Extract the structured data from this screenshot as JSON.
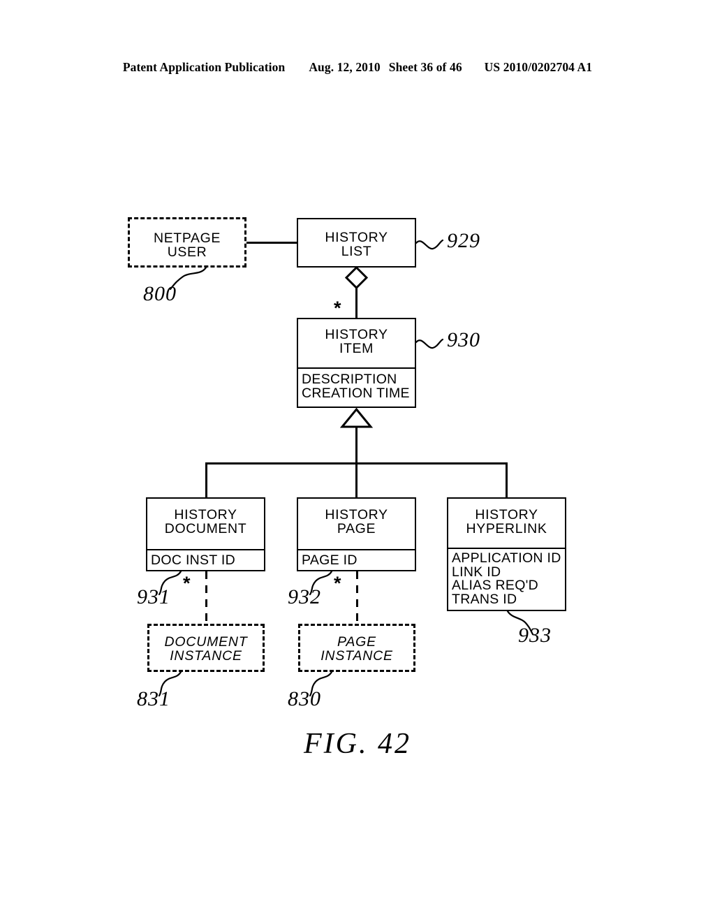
{
  "header": {
    "publication": "Patent Application Publication",
    "date": "Aug. 12, 2010",
    "sheet": "Sheet 36 of 46",
    "patent_number": "US 2010/0202704 A1"
  },
  "figure": {
    "caption": "FIG. 42",
    "type": "uml-class-diagram"
  },
  "nodes": {
    "netpage_user": {
      "title": "NETPAGE\nUSER",
      "ref": "800",
      "style": "dashed"
    },
    "history_list": {
      "title": "HISTORY\nLIST",
      "ref": "929",
      "style": "solid"
    },
    "history_item": {
      "title": "HISTORY\nITEM",
      "attributes": "DESCRIPTION\nCREATION TIME",
      "ref": "930",
      "style": "solid"
    },
    "history_document": {
      "title": "HISTORY\nDOCUMENT",
      "attributes": "DOC INST ID",
      "ref": "931",
      "style": "solid"
    },
    "history_page": {
      "title": "HISTORY\nPAGE",
      "attributes": "PAGE ID",
      "ref": "932",
      "style": "solid"
    },
    "history_hyperlink": {
      "title": "HISTORY\nHYPERLINK",
      "attributes": "APPLICATION ID\nLINK ID\nALIAS REQ'D\nTRANS ID",
      "ref": "933",
      "style": "solid"
    },
    "document_instance": {
      "title": "DOCUMENT\nINSTANCE",
      "ref": "831",
      "style": "dashed"
    },
    "page_instance": {
      "title": "PAGE\nINSTANCE",
      "ref": "830",
      "style": "solid"
    }
  },
  "multiplicities": {
    "list_to_item": "*",
    "document_to_instance": "*",
    "page_to_instance": "*"
  },
  "colors": {
    "line": "#000000",
    "background": "#ffffff"
  }
}
